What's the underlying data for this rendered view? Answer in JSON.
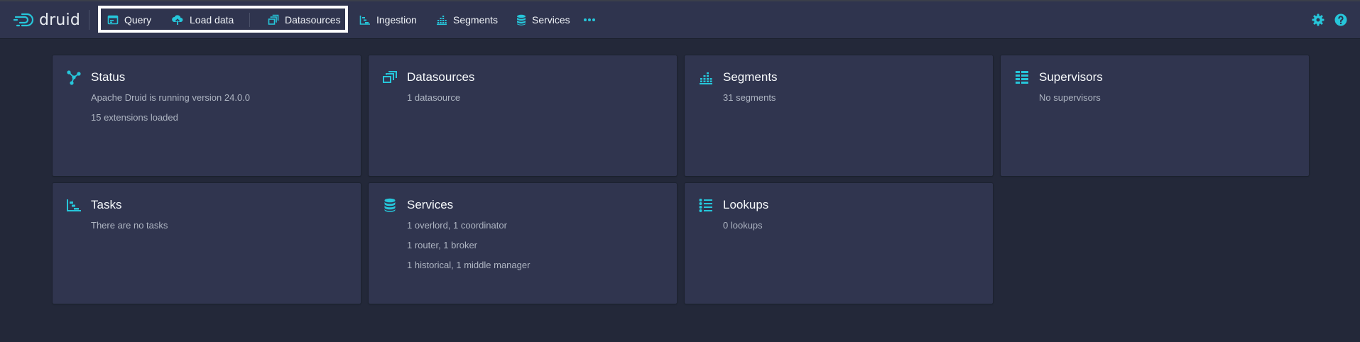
{
  "app": {
    "logo_text": "druid"
  },
  "nav": {
    "query": "Query",
    "load_data": "Load data",
    "datasources": "Datasources",
    "ingestion": "Ingestion",
    "segments": "Segments",
    "services": "Services",
    "more_icon": "more-icon",
    "settings_icon": "gear-icon",
    "help_icon": "help-icon"
  },
  "colors": {
    "accent": "#26c6da",
    "navbar": "#2f344e",
    "background": "#232839",
    "card": "#30354f"
  },
  "cards": {
    "status": {
      "title": "Status",
      "lines": [
        "Apache Druid is running version 24.0.0",
        "15 extensions loaded"
      ]
    },
    "datasources": {
      "title": "Datasources",
      "lines": [
        "1 datasource"
      ]
    },
    "segments": {
      "title": "Segments",
      "lines": [
        "31 segments"
      ]
    },
    "supervisors": {
      "title": "Supervisors",
      "lines": [
        "No supervisors"
      ]
    },
    "tasks": {
      "title": "Tasks",
      "lines": [
        "There are no tasks"
      ]
    },
    "services": {
      "title": "Services",
      "lines": [
        "1 overlord, 1 coordinator",
        "1 router, 1 broker",
        "1 historical, 1 middle manager"
      ]
    },
    "lookups": {
      "title": "Lookups",
      "lines": [
        "0 lookups"
      ]
    }
  }
}
